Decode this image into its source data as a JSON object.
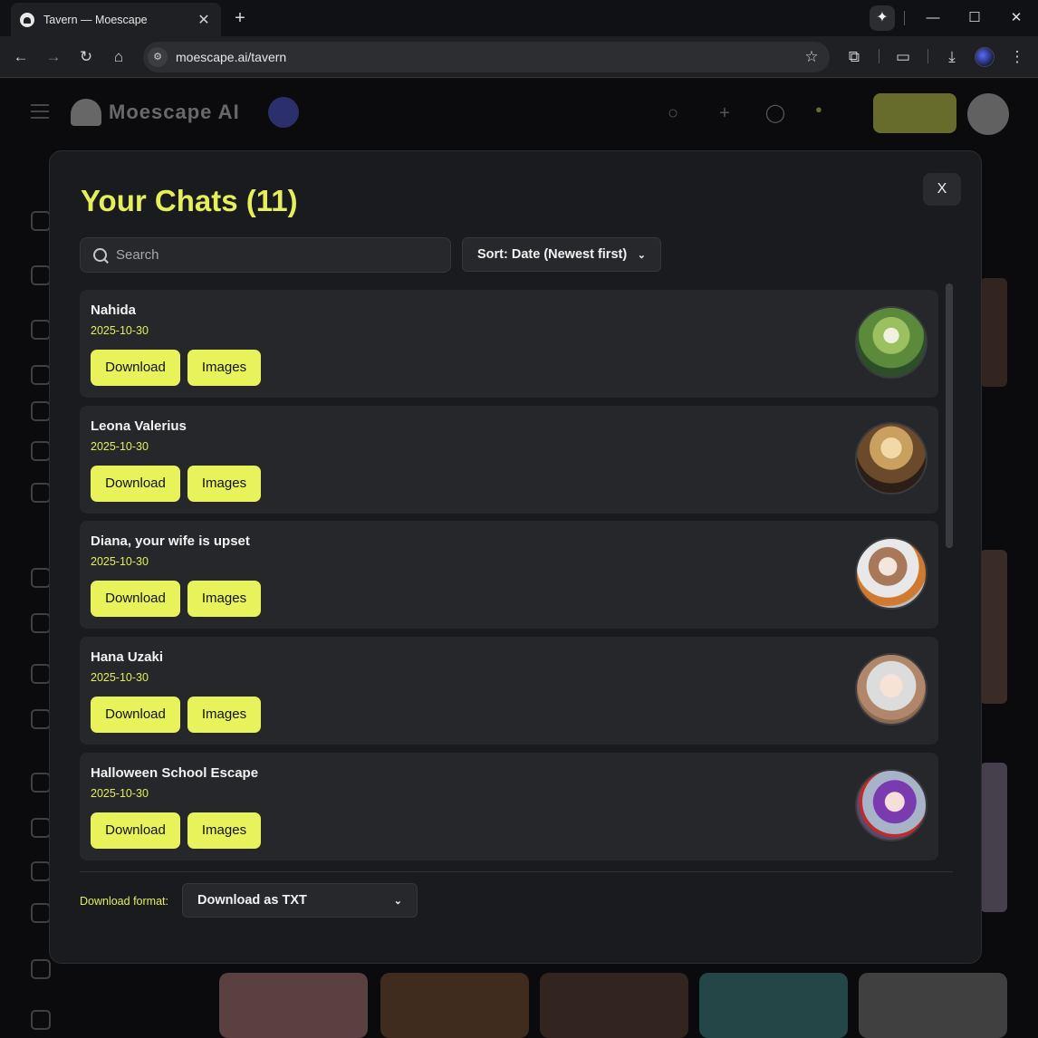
{
  "browser": {
    "tab_title": "Tavern — Moescape",
    "url_host": "moescape.ai",
    "url_path": "/tavern"
  },
  "site": {
    "logo_text": "Moescape AI"
  },
  "modal": {
    "title": "Your Chats (11)",
    "close_label": "X",
    "search_placeholder": "Search",
    "sort_value": "Sort: Date (Newest first)",
    "download_format_label": "Download format:",
    "download_format_value": "Download as TXT",
    "chats": [
      {
        "name": "Nahida",
        "date": "2025-10-30",
        "download_label": "Download",
        "images_label": "Images"
      },
      {
        "name": "Leona Valerius",
        "date": "2025-10-30",
        "download_label": "Download",
        "images_label": "Images"
      },
      {
        "name": "Diana, your wife is upset",
        "date": "2025-10-30",
        "download_label": "Download",
        "images_label": "Images"
      },
      {
        "name": "Hana Uzaki",
        "date": "2025-10-30",
        "download_label": "Download",
        "images_label": "Images"
      },
      {
        "name": "Halloween School Escape",
        "date": "2025-10-30",
        "download_label": "Download",
        "images_label": "Images"
      }
    ]
  },
  "colors": {
    "accent": "#e8f25a",
    "accent_text": "#e4ef5a",
    "modal_bg": "#1a1b1e",
    "card_bg": "#26272b"
  }
}
